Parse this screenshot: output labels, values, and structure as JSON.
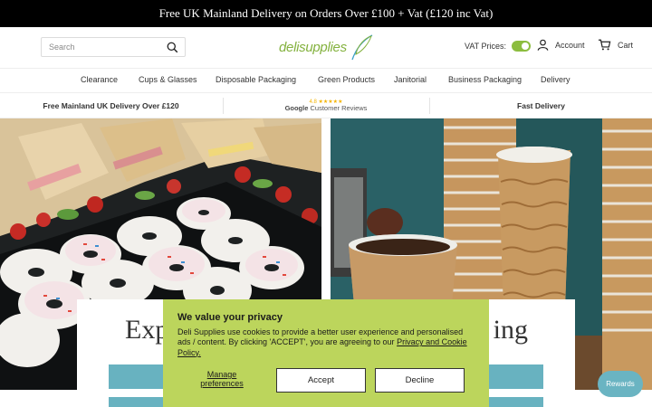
{
  "announcement": "Free UK Mainland Delivery on Orders Over £100 + Vat (£120 inc Vat)",
  "header": {
    "search_placeholder": "Search",
    "logo": "delisupplies",
    "vat_label": "VAT Prices:",
    "vat_enabled": true,
    "account_label": "Account",
    "cart_label": "Cart"
  },
  "nav": [
    "Clearance",
    "Cups & Glasses",
    "Disposable Packaging",
    "Green Products",
    "Janitorial",
    "Business Packaging",
    "Delivery"
  ],
  "usp": {
    "delivery": "Free Mainland UK Delivery Over £120",
    "rating": "4.8",
    "stars": "★★★★★",
    "google": "Google",
    "reviews": "Customer Reviews",
    "fast": "Fast Delivery"
  },
  "hero": {
    "title_left": "Exp",
    "title_right": "ing"
  },
  "cookie": {
    "title": "We value your privacy",
    "body": "Deli Supplies use cookies to provide a better user experience and personalised ads / content. By clicking 'ACCEPT', you are agreeing to our",
    "link": "Privacy and Cookie Policy.",
    "manage": "Manage preferences",
    "accept": "Accept",
    "decline": "Decline"
  },
  "rewards": "Rewards",
  "colors": {
    "announcement_bg": "#000000",
    "cookie_bg": "#bcd55c",
    "accent_teal": "#68b2c0",
    "toggle_green": "#8cbd3f"
  }
}
